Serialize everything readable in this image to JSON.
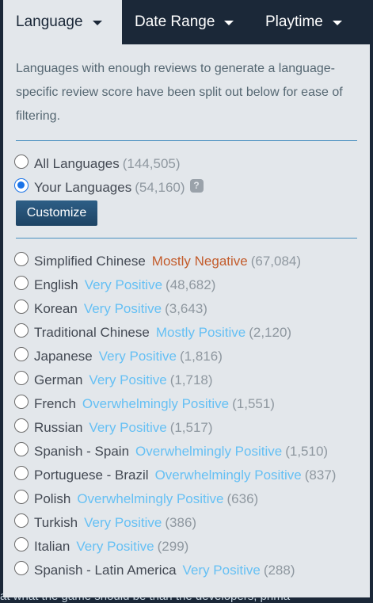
{
  "tabs": [
    {
      "label": "Language",
      "active": true
    },
    {
      "label": "Date Range",
      "active": false
    },
    {
      "label": "Playtime",
      "active": false
    }
  ],
  "intro_text": "Languages with enough reviews to generate a language-specific review score have been split out below for ease of filtering.",
  "general_options": [
    {
      "label": "All Languages",
      "count": "(144,505)",
      "checked": false
    },
    {
      "label": "Your Languages",
      "count": "(54,160)",
      "checked": true
    }
  ],
  "help_icon_label": "?",
  "customize_label": "Customize",
  "languages": [
    {
      "label": "Simplified Chinese",
      "score": "Mostly Negative",
      "count": "(67,084)",
      "color": "#c35c2c"
    },
    {
      "label": "English",
      "score": "Very Positive",
      "count": "(48,682)",
      "color": "#66c0f4"
    },
    {
      "label": "Korean",
      "score": "Very Positive",
      "count": "(3,643)",
      "color": "#66c0f4"
    },
    {
      "label": "Traditional Chinese",
      "score": "Mostly Positive",
      "count": "(2,120)",
      "color": "#66c0f4"
    },
    {
      "label": "Japanese",
      "score": "Very Positive",
      "count": "(1,816)",
      "color": "#66c0f4"
    },
    {
      "label": "German",
      "score": "Very Positive",
      "count": "(1,718)",
      "color": "#66c0f4"
    },
    {
      "label": "French",
      "score": "Overwhelmingly Positive",
      "count": "(1,551)",
      "color": "#66c0f4"
    },
    {
      "label": "Russian",
      "score": "Very Positive",
      "count": "(1,517)",
      "color": "#66c0f4"
    },
    {
      "label": "Spanish - Spain",
      "score": "Overwhelmingly Positive",
      "count": "(1,510)",
      "color": "#66c0f4"
    },
    {
      "label": "Portuguese - Brazil",
      "score": "Overwhelmingly Positive",
      "count": "(837)",
      "color": "#66c0f4"
    },
    {
      "label": "Polish",
      "score": "Overwhelmingly Positive",
      "count": "(636)",
      "color": "#66c0f4"
    },
    {
      "label": "Turkish",
      "score": "Very Positive",
      "count": "(386)",
      "color": "#66c0f4"
    },
    {
      "label": "Italian",
      "score": "Very Positive",
      "count": "(299)",
      "color": "#66c0f4"
    },
    {
      "label": "Spanish - Latin America",
      "score": "Very Positive",
      "count": "(288)",
      "color": "#66c0f4"
    }
  ],
  "background_snippet": "at what the game should be than the developers, prima"
}
